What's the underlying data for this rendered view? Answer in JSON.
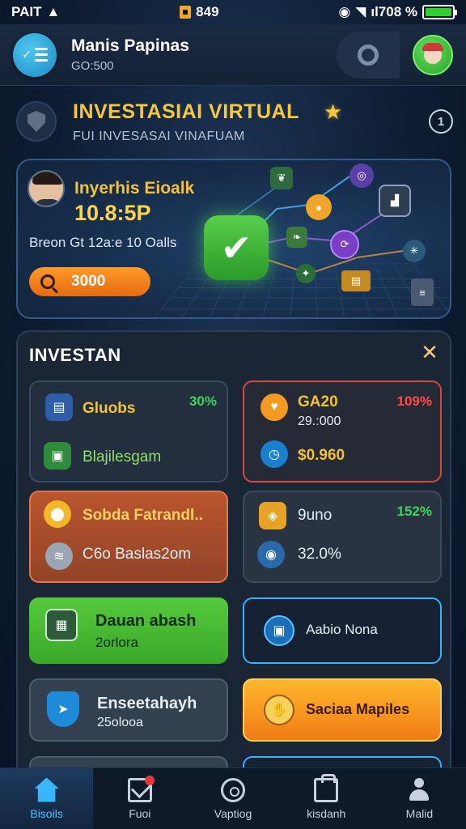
{
  "status_bar": {
    "left_text": "PAIT",
    "center_text": "849",
    "right_text": "ıl708 %"
  },
  "header": {
    "profile_name": "Manis Papinas",
    "profile_sub": "GO:500"
  },
  "title": {
    "main": "INVESTASIAI VIRTUAL",
    "sub": "FUI INVESASAI VINAFUAM",
    "info": "1"
  },
  "hero": {
    "name": "Inyerhis Eioalk",
    "amount": "10.8:5P",
    "caption": "Breon Gt 12a:e 10 Oalls",
    "search_value": "3000"
  },
  "panel": {
    "title": "INVESTAN",
    "close": "✕",
    "tiles": [
      {
        "label": "Gluobs",
        "pct": "30%",
        "text": "Blajilesgam"
      },
      {
        "label": "GA20",
        "pct": "109%",
        "text": "29.:000",
        "value": "$0.960"
      },
      {
        "label": "Sobda Fatrandl..",
        "text": "C6o Baslas2om"
      },
      {
        "label": "9uno",
        "pct": "152%",
        "value": "32.0%"
      },
      {
        "label": "Dauan abash",
        "text": "2orlora"
      },
      {
        "label": "Aabio Nona"
      },
      {
        "label": "Enseetahayh",
        "text": "25olooa"
      },
      {
        "label": "Saciaa Mapiles"
      }
    ]
  },
  "nav": [
    {
      "label": "Bisoils",
      "icon": "home-icon"
    },
    {
      "label": "Fuoi",
      "icon": "mail-icon"
    },
    {
      "label": "Vaptiog",
      "icon": "circle-icon"
    },
    {
      "label": "kisdanh",
      "icon": "bag-icon"
    },
    {
      "label": "Malid",
      "icon": "person-icon"
    }
  ],
  "colors": {
    "accent_gold": "#f6c73b",
    "accent_blue": "#36b2ff",
    "accent_green": "#56c93c",
    "accent_red": "#d4493c",
    "accent_orange": "#f07c14"
  }
}
